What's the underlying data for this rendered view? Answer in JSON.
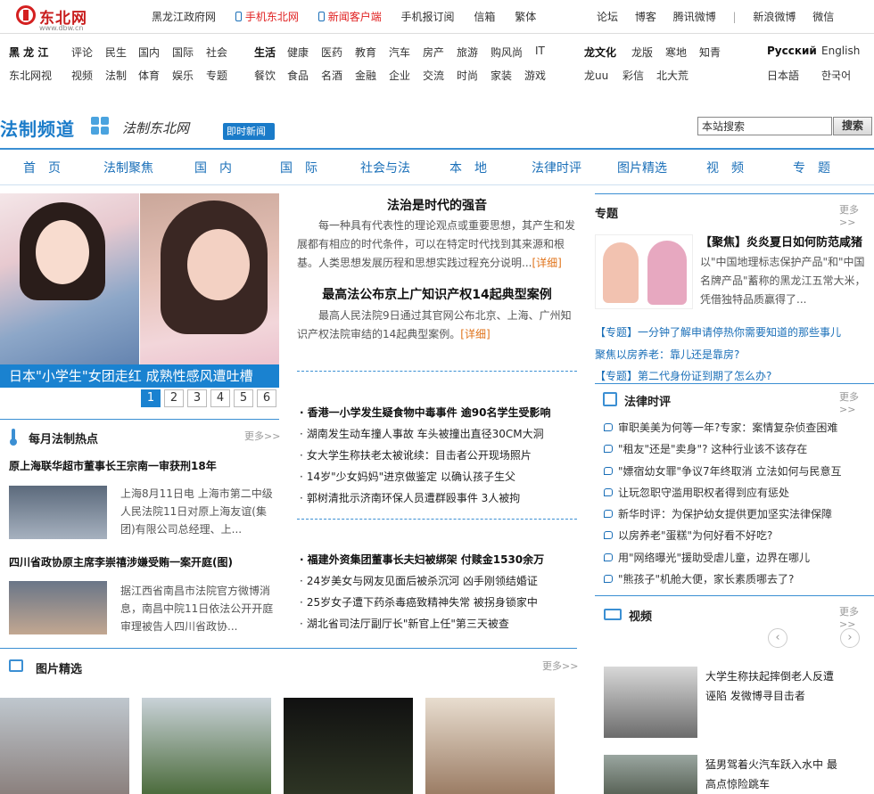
{
  "logo": {
    "name": "东北网",
    "url": "www.dbw.cn"
  },
  "top": {
    "links": [
      "黑龙江政府网",
      "手机东北网",
      "新闻客户端",
      "手机报订阅",
      "信箱",
      "繁体"
    ],
    "right": [
      "论坛",
      "博客",
      "腾讯微博",
      "|",
      "新浪微博",
      "微信"
    ]
  },
  "nav": {
    "row1": [
      "黑 龙 江",
      "评论",
      "民生",
      "国内",
      "国际",
      "社会",
      "生活",
      "健康",
      "医药",
      "教育",
      "汽车",
      "房产",
      "旅游",
      "购风尚",
      "IT",
      "龙文化",
      "龙版",
      "寒地",
      "知青",
      "Русский",
      "English"
    ],
    "row2": [
      "东北网视",
      "视频",
      "法制",
      "体育",
      "娱乐",
      "专题",
      "餐饮",
      "食品",
      "名酒",
      "金融",
      "企业",
      "交流",
      "时尚",
      "家装",
      "游戏",
      "龙uu",
      "彩信",
      "北大荒",
      "日本語",
      "한국어"
    ]
  },
  "channel": {
    "name": "法制频道",
    "slogan": "法制东北网",
    "badge": "即时新闻",
    "search_placeholder": "本站搜索",
    "search_btn": "搜索"
  },
  "mainnav": [
    "首　页",
    "法制聚焦",
    "国　内",
    "国　际",
    "社会与法",
    "本　地",
    "法律时评",
    "图片精选",
    "视　频",
    "专　题"
  ],
  "slide": {
    "caption": "日本\"小学生\"女团走红 成熟性感风遭吐槽",
    "pages": [
      "1",
      "2",
      "3",
      "4",
      "5",
      "6"
    ]
  },
  "hot": {
    "title": "每月法制热点",
    "more": "更多>>",
    "items": [
      {
        "headline": "原上海联华超市董事长王宗南一审获刑18年",
        "summary": "上海8月11日电 上海市第二中级人民法院11日对原上海友谊(集团)有限公司总经理、上..."
      },
      {
        "headline": "四川省政协原主席李崇禧涉嫌受贿一案开庭(图)",
        "summary": "据江西省南昌市法院官方微博消息，南昌中院11日依法公开开庭审理被告人四川省政协..."
      }
    ]
  },
  "center": {
    "a1": {
      "title": "法治是时代的强音",
      "body": "每一种具有代表性的理论观点或重要思想，其产生和发展都有相应的时代条件，可以在特定时代找到其来源和根基。人类思想发展历程和思想实践过程充分说明...",
      "more": "[详细]"
    },
    "a2": {
      "title": "最高法公布京上广知识产权14起典型案例",
      "body": "最高人民法院9日通过其官网公布北京、上海、广州知识产权法院审结的14起典型案例。",
      "more": "[详细]"
    },
    "list1": [
      "香港一小学发生疑食物中毒事件 逾90名学生受影响",
      "湖南发生动车撞人事故 车头被撞出直径30CM大洞",
      "女大学生称扶老太被讹续：目击者公开现场照片",
      "14岁\"少女妈妈\"进京做鉴定 以确认孩子生父",
      "郭树清批示济南环保人员遭群殴事件 3人被拘"
    ],
    "list2": [
      "福建外资集团董事长夫妇被绑架 付赎金1530余万",
      "24岁美女与网友见面后被杀沉河 凶手刚领结婚证",
      "25岁女子遭下药杀毒癌致精神失常 被拐身锁家中",
      "湖北省司法厅副厅长\"新官上任\"第三天被查"
    ]
  },
  "special": {
    "title": "专题",
    "more": "更多>>",
    "feature_title": "【聚焦】炎炎夏日如何防范咸猪",
    "feature_body": "以\"中国地理标志保护产品\"和\"中国名牌产品\"蓄称的黑龙江五常大米，凭借独特品质赢得了...",
    "links": [
      "【专题】一分钟了解申请停热你需要知道的那些事儿",
      "聚焦以房养老：靠儿还是靠房?",
      "【专题】第二代身份证到期了怎么办?"
    ]
  },
  "law": {
    "title": "法律时评",
    "more": "更多>>",
    "items": [
      "审职美美为何等一年?专家：案情复杂侦查困难",
      "\"租友\"还是\"卖身\"? 这种行业该不该存在",
      "\"嫖宿幼女罪\"争议7年终取消 立法如何与民意互",
      "让玩忽职守滥用职权者得到应有惩处",
      "新华时评：为保护幼女提供更加坚实法律保障",
      "以房养老\"蛋糕\"为何好看不好吃?",
      "用\"网络曝光\"援助受虐儿童，边界在哪儿",
      "\"熊孩子\"机舱大便，家长素质哪去了?"
    ]
  },
  "video": {
    "title": "视频",
    "more": "更多>>",
    "items": [
      "大学生称扶起摔倒老人反遭诬陷 发微博寻目击者",
      "猛男驾着火汽车跃入水中 最高点惊险跳车"
    ]
  },
  "photos": {
    "title": "图片精选",
    "more": "更多>>"
  },
  "colors": {
    "accent": "#1a82d0",
    "link": "#1a6fb8",
    "red": "#e02020"
  }
}
